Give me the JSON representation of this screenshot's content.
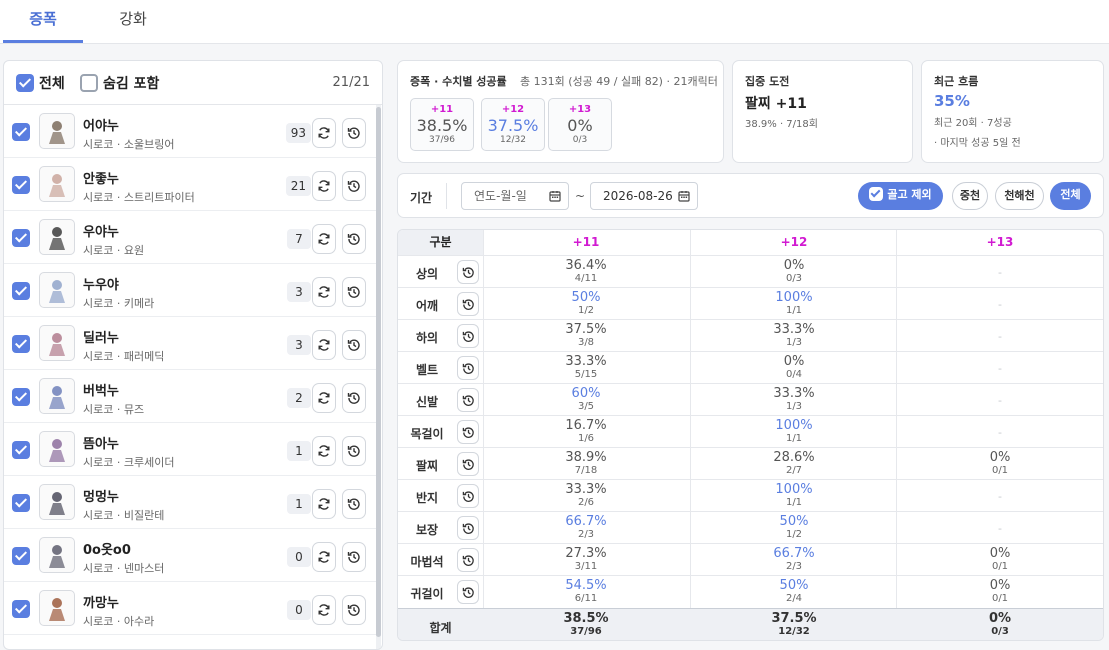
{
  "tabs": [
    {
      "label": "증폭"
    },
    {
      "label": "강화"
    }
  ],
  "left": {
    "all_label": "전체",
    "hidden_label": "숨김 포함",
    "count": "21/21",
    "characters": [
      {
        "name": "어야누",
        "sub": "시로코 · 소울브링어",
        "count": "93"
      },
      {
        "name": "안좋누",
        "sub": "시로코 · 스트리트파이터",
        "count": "21"
      },
      {
        "name": "우야누",
        "sub": "시로코 · 요원",
        "count": "7"
      },
      {
        "name": "누우야",
        "sub": "시로코 · 키메라",
        "count": "3"
      },
      {
        "name": "딜러누",
        "sub": "시로코 · 패러메딕",
        "count": "3"
      },
      {
        "name": "버벅누",
        "sub": "시로코 · 뮤즈",
        "count": "2"
      },
      {
        "name": "뜸아누",
        "sub": "시로코 · 크루세이더",
        "count": "1"
      },
      {
        "name": "멍멍누",
        "sub": "시로코 · 비질란테",
        "count": "1"
      },
      {
        "name": "0o옷o0",
        "sub": "시로코 · 넨마스터",
        "count": "0"
      },
      {
        "name": "까망누",
        "sub": "시로코 · 아수라",
        "count": "0"
      }
    ]
  },
  "card1": {
    "title": "증폭 · 수치별 성공률",
    "summary": "총 131회 (성공 49 / 실패 82) · 21캐릭터",
    "boxes": [
      {
        "level": "+11",
        "pct": "38.5%",
        "frac": "37/96"
      },
      {
        "level": "+12",
        "pct": "37.5%",
        "frac": "12/32"
      },
      {
        "level": "+13",
        "pct": "0%",
        "frac": "0/3"
      }
    ]
  },
  "card2": {
    "title": "집중 도전",
    "main": "팔찌 +11",
    "sub": "38.9% · 7/18회"
  },
  "card3": {
    "title": "최근 흐름",
    "main": "35%",
    "sub1": "최근 20회 · 7성공",
    "sub2": "· 마지막 성공 5일 전"
  },
  "filter": {
    "label": "기간",
    "start_placeholder": "연도-월-일",
    "tilde": "~",
    "end_value": "2026-08-26",
    "exclude_label": "골고 제외",
    "presets": [
      "중천",
      "천해천",
      "전체"
    ]
  },
  "table": {
    "headers": [
      "구분",
      "+11",
      "+12",
      "+13"
    ],
    "rows": [
      {
        "label": "상의",
        "c11": {
          "p": "36.4%",
          "f": "4/11"
        },
        "c12": {
          "p": "0%",
          "f": "0/3"
        },
        "c13": {
          "p": "-",
          "f": ""
        }
      },
      {
        "label": "어깨",
        "c11": {
          "p": "50%",
          "f": "1/2"
        },
        "c12": {
          "p": "100%",
          "f": "1/1"
        },
        "c13": {
          "p": "-",
          "f": ""
        }
      },
      {
        "label": "하의",
        "c11": {
          "p": "37.5%",
          "f": "3/8"
        },
        "c12": {
          "p": "33.3%",
          "f": "1/3"
        },
        "c13": {
          "p": "-",
          "f": ""
        }
      },
      {
        "label": "벨트",
        "c11": {
          "p": "33.3%",
          "f": "5/15"
        },
        "c12": {
          "p": "0%",
          "f": "0/4"
        },
        "c13": {
          "p": "-",
          "f": ""
        }
      },
      {
        "label": "신발",
        "c11": {
          "p": "60%",
          "f": "3/5"
        },
        "c12": {
          "p": "33.3%",
          "f": "1/3"
        },
        "c13": {
          "p": "-",
          "f": ""
        }
      },
      {
        "label": "목걸이",
        "c11": {
          "p": "16.7%",
          "f": "1/6"
        },
        "c12": {
          "p": "100%",
          "f": "1/1"
        },
        "c13": {
          "p": "-",
          "f": ""
        }
      },
      {
        "label": "팔찌",
        "c11": {
          "p": "38.9%",
          "f": "7/18"
        },
        "c12": {
          "p": "28.6%",
          "f": "2/7"
        },
        "c13": {
          "p": "0%",
          "f": "0/1"
        }
      },
      {
        "label": "반지",
        "c11": {
          "p": "33.3%",
          "f": "2/6"
        },
        "c12": {
          "p": "100%",
          "f": "1/1"
        },
        "c13": {
          "p": "-",
          "f": ""
        }
      },
      {
        "label": "보장",
        "c11": {
          "p": "66.7%",
          "f": "2/3"
        },
        "c12": {
          "p": "50%",
          "f": "1/2"
        },
        "c13": {
          "p": "-",
          "f": ""
        }
      },
      {
        "label": "마법석",
        "c11": {
          "p": "27.3%",
          "f": "3/11"
        },
        "c12": {
          "p": "66.7%",
          "f": "2/3"
        },
        "c13": {
          "p": "0%",
          "f": "0/1"
        }
      },
      {
        "label": "귀걸이",
        "c11": {
          "p": "54.5%",
          "f": "6/11"
        },
        "c12": {
          "p": "50%",
          "f": "2/4"
        },
        "c13": {
          "p": "0%",
          "f": "0/1"
        }
      }
    ],
    "total": {
      "label": "합계",
      "c11": {
        "p": "38.5%",
        "f": "37/96"
      },
      "c12": {
        "p": "37.5%",
        "f": "12/32"
      },
      "c13": {
        "p": "0%",
        "f": "0/3"
      }
    }
  },
  "colors": {
    "accent": "#5a7ee0",
    "level": "#d11ad1",
    "dash": "#c6c9ce"
  },
  "icons": {
    "refresh": "refresh-icon",
    "history": "history-icon",
    "calendar": "calendar-icon"
  }
}
